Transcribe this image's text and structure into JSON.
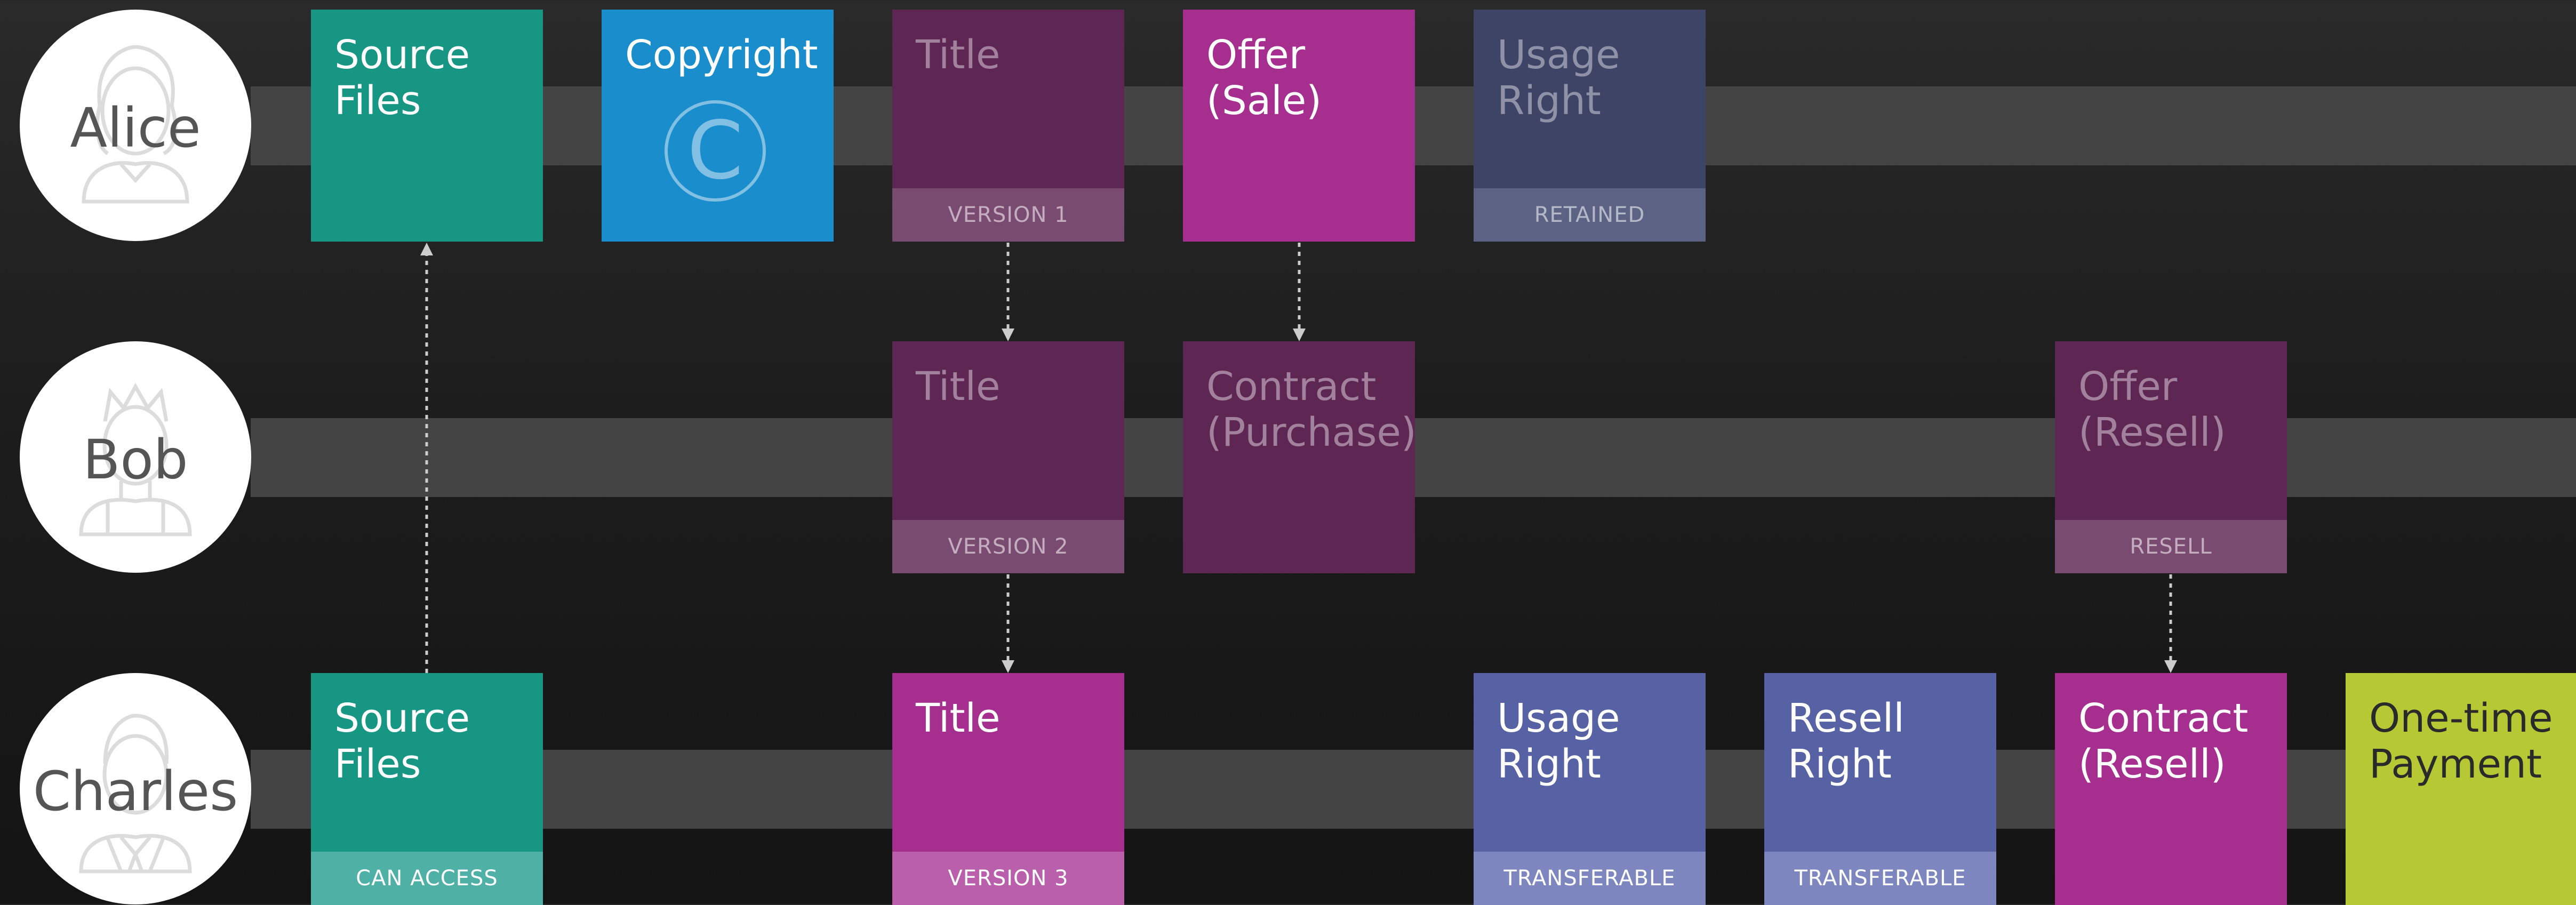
{
  "actors": {
    "alice": {
      "name": "Alice"
    },
    "bob": {
      "name": "Bob"
    },
    "charles": {
      "name": "Charles"
    }
  },
  "cards": {
    "alice_source_files": {
      "title": "Source\nFiles"
    },
    "alice_copyright": {
      "title": "Copyright",
      "symbol": "C"
    },
    "alice_title": {
      "title": "Title",
      "badge": "VERSION 1"
    },
    "alice_offer": {
      "title": "Offer\n(Sale)"
    },
    "alice_usage_right": {
      "title": "Usage\nRight",
      "badge": "RETAINED"
    },
    "bob_title": {
      "title": "Title",
      "badge": "VERSION 2"
    },
    "bob_contract": {
      "title": "Contract\n(Purchase)"
    },
    "bob_offer": {
      "title": "Offer\n(Resell)",
      "badge": "RESELL"
    },
    "charles_source_files": {
      "title": "Source\nFiles",
      "badge": "CAN ACCESS"
    },
    "charles_title": {
      "title": "Title",
      "badge": "VERSION 3"
    },
    "charles_usage_right": {
      "title": "Usage\nRight",
      "badge": "TRANSFERABLE"
    },
    "charles_resell_right": {
      "title": "Resell\nRight",
      "badge": "TRANSFERABLE"
    },
    "charles_contract": {
      "title": "Contract\n(Resell)"
    },
    "charles_payment": {
      "title": "One-time\nPayment"
    }
  },
  "colors": {
    "teal": "#169683",
    "teal_badge": "#4fb0a6",
    "blue": "#1a8dcc",
    "magenta": "#a52e8f",
    "magenta_badge": "#ba5fac",
    "indigo": "#5762a4",
    "indigo_badge": "#7d86bf",
    "lime": "#b6c935",
    "faded_magenta": "#5e2753",
    "faded_magenta_badge": "#7a4b70",
    "faded_indigo": "#3e4466",
    "faded_indigo_badge": "#5b6284"
  }
}
